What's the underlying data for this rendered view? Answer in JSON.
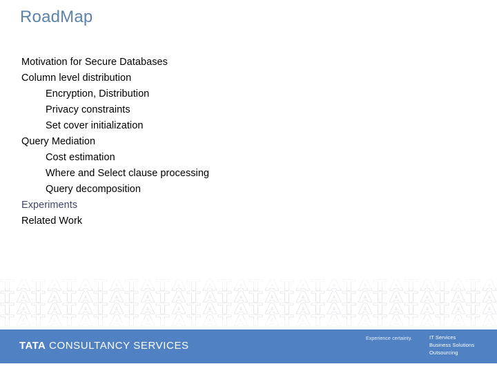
{
  "slide": {
    "title": "Road­Map",
    "title_text": "RoadMap",
    "accent_color": "#5e82ab",
    "background_color": "#ffffff"
  },
  "outline": {
    "items": [
      {
        "text": "Motivation for Secure Databases",
        "level": 1,
        "color": "#000000"
      },
      {
        "text": "Column level distribution",
        "level": 1,
        "color": "#000000"
      },
      {
        "text": "Encryption, Distribution",
        "level": 2,
        "color": "#000000"
      },
      {
        "text": "Privacy constraints",
        "level": 2,
        "color": "#000000"
      },
      {
        "text": "Set cover initialization",
        "level": 2,
        "color": "#000000"
      },
      {
        "text": "Query Mediation",
        "level": 1,
        "color": "#000000"
      },
      {
        "text": "Cost estimation",
        "level": 2,
        "color": "#000000"
      },
      {
        "text": "Where and Select clause processing",
        "level": 2,
        "color": "#000000"
      },
      {
        "text": "Query decomposition",
        "level": 2,
        "color": "#000000"
      },
      {
        "text": "Experiments",
        "level": 1,
        "color": "#44466b"
      },
      {
        "text": "Related Work",
        "level": 1,
        "color": "#000000"
      }
    ]
  },
  "footer": {
    "bar_color": "#4f81c3",
    "watermark_text": "TA",
    "logo": {
      "brand": "TATA",
      "name": "CONSULTANCY SERVICES"
    },
    "tagline": "Experience certainty.",
    "services": [
      "IT Services",
      "Business Solutions",
      "Outsourcing"
    ]
  }
}
